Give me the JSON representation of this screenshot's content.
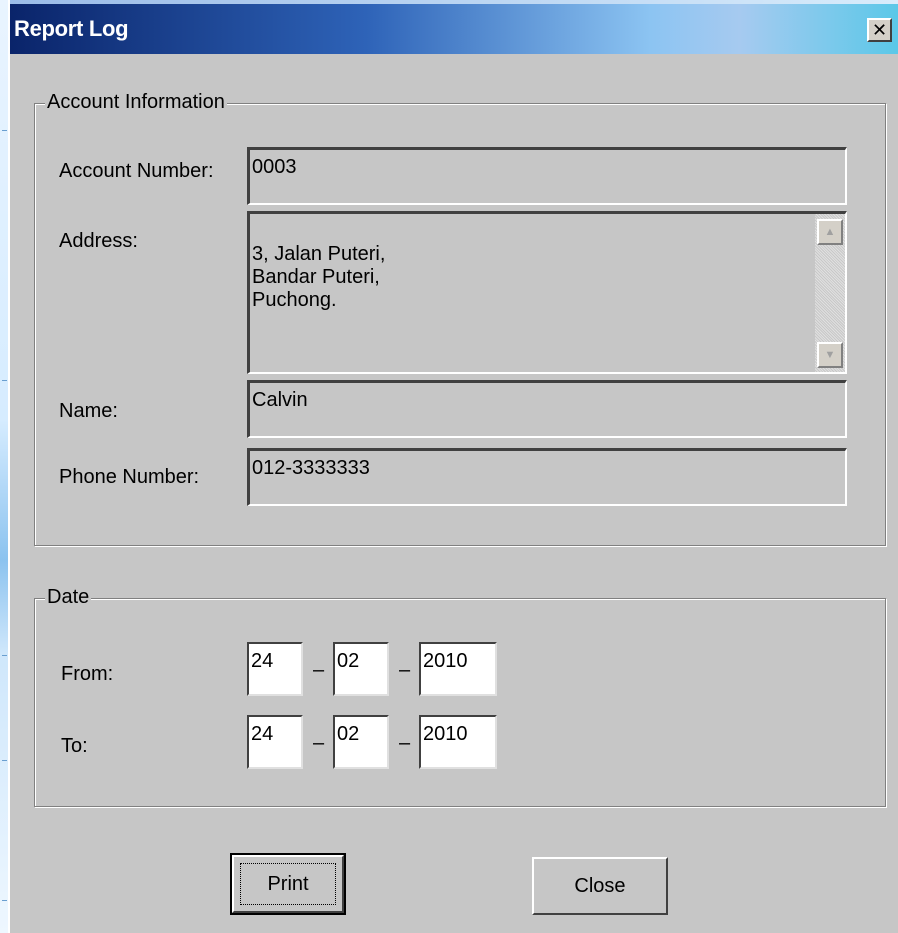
{
  "window": {
    "title": "Report Log",
    "close_glyph": "✕"
  },
  "account": {
    "legend": "Account Information",
    "account_number_label": "Account Number:",
    "account_number": "0003",
    "address_label": "Address:",
    "address": "3, Jalan Puteri,\nBandar Puteri,\nPuchong.",
    "name_label": "Name:",
    "name": "Calvin",
    "phone_label": "Phone Number:",
    "phone": "012-3333333"
  },
  "date": {
    "legend": "Date",
    "from_label": "From:",
    "to_label": "To:",
    "separator": "–",
    "from": {
      "day": "24",
      "month": "02",
      "year": "2010"
    },
    "to": {
      "day": "24",
      "month": "02",
      "year": "2010"
    }
  },
  "buttons": {
    "print": "Print",
    "close": "Close"
  },
  "icons": {
    "scroll_up": "scroll-up-arrow-icon",
    "scroll_down": "scroll-down-arrow-icon"
  }
}
